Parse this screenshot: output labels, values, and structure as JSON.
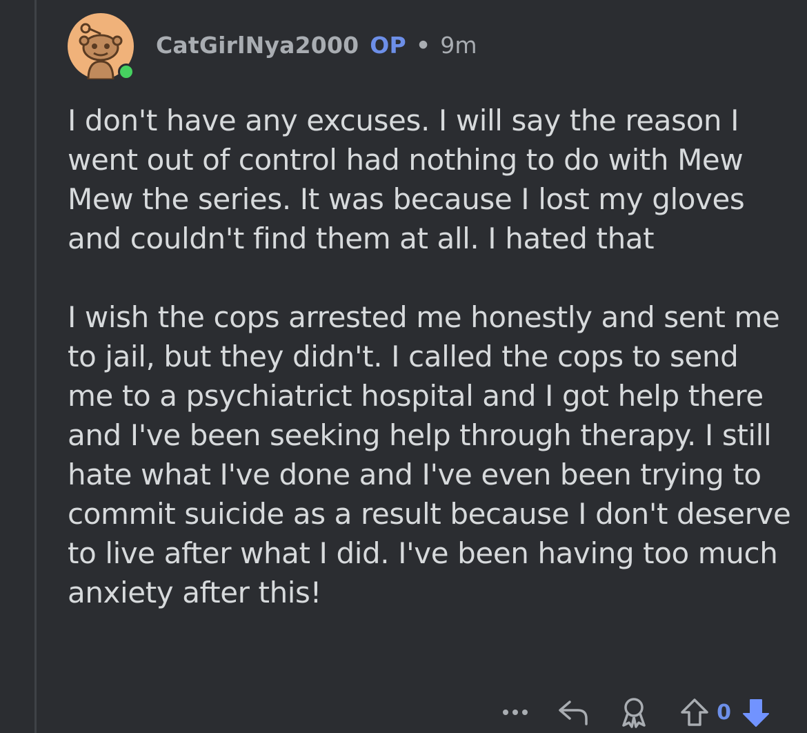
{
  "comment": {
    "username": "CatGirlNya2000",
    "op_badge": "OP",
    "separator": "•",
    "time": "9m",
    "online": true,
    "paragraphs": [
      "I don't have any excuses. I will say the reason I went out of control had nothing to do with Mew Mew the series. It was because I lost my gloves and couldn't find them at all. I hated that",
      "I wish the cops arrested me honestly and sent me to jail, but they didn't. I called the cops to send me to a psychiatrict hospital and I got help there and I've been seeking help through therapy. I still hate what I've done and I've even been trying to commit suicide as a result because I don't deserve to live after what I did. I've been having too much anxiety after this!"
    ]
  },
  "actions": {
    "more_icon": "more-dots-icon",
    "reply_icon": "reply-arrow-icon",
    "award_icon": "award-ribbon-icon",
    "upvote_icon": "upvote-arrow-icon",
    "vote_count": "0",
    "downvote_icon": "downvote-arrow-icon"
  },
  "colors": {
    "background": "#2b2d31",
    "text": "#d7dadc",
    "muted": "#a9adb2",
    "op": "#6d8fe8",
    "downvote_active": "#7193ff",
    "online": "#46d160"
  }
}
